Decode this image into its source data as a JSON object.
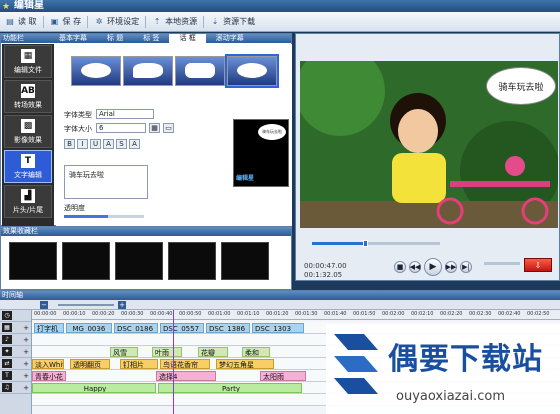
{
  "app": {
    "title": "编辑星"
  },
  "toolbar": {
    "items": [
      {
        "label": "读 取",
        "icon": "open-icon"
      },
      {
        "label": "保 存",
        "icon": "save-icon"
      },
      {
        "label": "环境设定",
        "icon": "settings-icon"
      },
      {
        "label": "本地资源",
        "icon": "import-icon"
      },
      {
        "label": "资源下载",
        "icon": "download-icon"
      }
    ]
  },
  "left_panel": {
    "title": "功能栏",
    "tabs": [
      "基本字幕",
      "标 题",
      "标 签",
      "话 框",
      "滚动字幕"
    ],
    "active_tab": 3,
    "nav": [
      {
        "label": "编辑文件",
        "icon": "film-icon"
      },
      {
        "label": "转场效果",
        "icon": "transition-icon"
      },
      {
        "label": "影像效果",
        "icon": "effects-icon"
      },
      {
        "label": "文字编辑",
        "icon": "text-icon",
        "glyph": "T"
      },
      {
        "label": "片头/片尾",
        "icon": "credits-icon"
      }
    ],
    "active_nav": 3,
    "font_type_label": "字体类型",
    "font_type_value": "Arial",
    "font_size_label": "字体大小",
    "font_size_value": "6",
    "style_buttons": [
      "B",
      "I",
      "U",
      "A",
      "S",
      "A"
    ],
    "text_value": "骑车玩去啦",
    "opacity_label": "透明度",
    "opacity_level": 0.55,
    "preview_logo": "编辑星",
    "preview_bubble_text": "骑车玩去啦"
  },
  "favorites": {
    "title": "效果收藏栏"
  },
  "player": {
    "bubble_text": "骑车玩去啦",
    "time_current": "00:00:47.00",
    "time_total": "00:1:32.05",
    "progress": 0.42,
    "controls": [
      "stop-icon",
      "prev-icon",
      "play-icon",
      "next-icon",
      "end-icon"
    ],
    "control_glyphs": [
      "■",
      "◀◀",
      "▶",
      "▶▶",
      "▶|"
    ]
  },
  "timeline": {
    "title": "时间轴",
    "ruler": [
      "00:00:00",
      "00:00:10",
      "00:00:20",
      "00:00:30",
      "00:00:40",
      "00:00:50",
      "00:01:00",
      "00:01:10",
      "00:01:20",
      "00:01:30",
      "00:01:40",
      "00:01:50",
      "00:02:00",
      "00:02:10",
      "00:02:20",
      "00:02:30",
      "00:02:40",
      "00:02:50"
    ],
    "track1": [
      "打字机",
      "_MG_0036",
      "DSC_0186",
      "DSC_0557",
      "DSC_1386",
      "DSC_1303"
    ],
    "track3": [
      "风雪",
      "叶雨",
      "花瓣",
      "柔和"
    ],
    "track4": [
      "淡入White",
      "透明翻页",
      "钉相片",
      "鸟语花香帘",
      "梦幻五角星"
    ],
    "track5": [
      "青春小花",
      "选择4",
      "太阳雨"
    ],
    "track6": [
      "Happy",
      "Party"
    ]
  },
  "watermark": {
    "text": "偶要下载站",
    "url": "ouyaoxiazai.com"
  }
}
